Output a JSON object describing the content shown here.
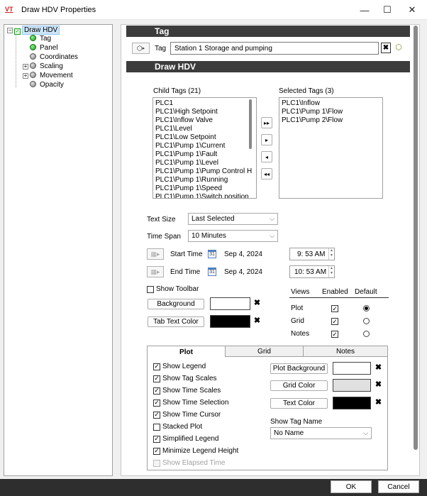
{
  "window": {
    "logo": "VT",
    "title": "Draw HDV Properties",
    "minimize": "—",
    "maximize": "☐",
    "close": "✕"
  },
  "tree": {
    "root": "Draw HDV",
    "items": [
      {
        "label": "Tag",
        "status": "green",
        "expandable": false
      },
      {
        "label": "Panel",
        "status": "green",
        "expandable": false
      },
      {
        "label": "Coordinates",
        "status": "gray",
        "expandable": false
      },
      {
        "label": "Scaling",
        "status": "gray",
        "expandable": true
      },
      {
        "label": "Movement",
        "status": "gray",
        "expandable": true
      },
      {
        "label": "Opacity",
        "status": "gray",
        "expandable": false
      }
    ]
  },
  "tag_section": {
    "header": "Tag",
    "label": "Tag",
    "value": "Station 1   Storage and pumping"
  },
  "draw_section": {
    "header": "Draw HDV",
    "child_tags_label": "Child Tags (21)",
    "child_tags": [
      "PLC1",
      "PLC1\\High Setpoint",
      "PLC1\\Inflow Valve",
      "PLC1\\Level",
      "PLC1\\Low Setpoint",
      "PLC1\\Pump 1\\Current",
      "PLC1\\Pump 1\\Fault",
      "PLC1\\Pump 1\\Level",
      "PLC1\\Pump 1\\Pump Control H",
      "PLC1\\Pump 1\\Running",
      "PLC1\\Pump 1\\Speed",
      "PLC1\\Pump 1\\Switch position"
    ],
    "selected_tags_label": "Selected Tags (3)",
    "selected_tags": [
      "PLC1\\Inflow",
      "PLC1\\Pump 1\\Flow",
      "PLC1\\Pump 2\\Flow"
    ],
    "move_buttons": [
      "▸▸",
      "▸",
      "◂",
      "◂◂"
    ]
  },
  "settings": {
    "text_size_label": "Text Size",
    "text_size_value": "Last Selected",
    "time_span_label": "Time Span",
    "time_span_value": "10 Minutes",
    "start_time_label": "Start Time",
    "start_date": "Sep 4, 2024",
    "start_time": "9: 53 AM",
    "end_time_label": "End Time",
    "end_date": "Sep 4, 2024",
    "end_time": "10: 53 AM",
    "show_toolbar_label": "Show Toolbar",
    "background_label": "Background",
    "tab_text_color_label": "Tab Text Color",
    "background_color": "#ffffff",
    "tab_text_color": "#000000",
    "calendar_day": "31"
  },
  "views": {
    "header_views": "Views",
    "header_enabled": "Enabled",
    "header_default": "Default",
    "rows": [
      {
        "name": "Plot",
        "enabled": true,
        "default": true
      },
      {
        "name": "Grid",
        "enabled": true,
        "default": false
      },
      {
        "name": "Notes",
        "enabled": true,
        "default": false
      }
    ]
  },
  "tabs": {
    "items": [
      "Plot",
      "Grid",
      "Notes"
    ],
    "active": "Plot"
  },
  "plot_options": [
    {
      "label": "Show Legend",
      "checked": true,
      "disabled": false
    },
    {
      "label": "Show Tag Scales",
      "checked": true,
      "disabled": false
    },
    {
      "label": "Show Time Scales",
      "checked": true,
      "disabled": false
    },
    {
      "label": "Show Time Selection",
      "checked": true,
      "disabled": false
    },
    {
      "label": "Show Time Cursor",
      "checked": true,
      "disabled": false
    },
    {
      "label": "Stacked Plot",
      "checked": false,
      "disabled": false
    },
    {
      "label": "Simplified Legend",
      "checked": true,
      "disabled": false
    },
    {
      "label": "Minimize Legend Height",
      "checked": true,
      "disabled": false
    },
    {
      "label": "Show Elapsed Time",
      "checked": false,
      "disabled": true
    }
  ],
  "plot_colors": {
    "plot_background_label": "Plot Background",
    "grid_color_label": "Grid Color",
    "text_color_label": "Text Color",
    "plot_background": "#ffffff",
    "grid_color": "#e0e0e0",
    "text_color": "#000000",
    "show_tag_name_label": "Show Tag Name",
    "show_tag_name_value": "No Name"
  },
  "footer": {
    "ok": "OK",
    "cancel": "Cancel"
  }
}
